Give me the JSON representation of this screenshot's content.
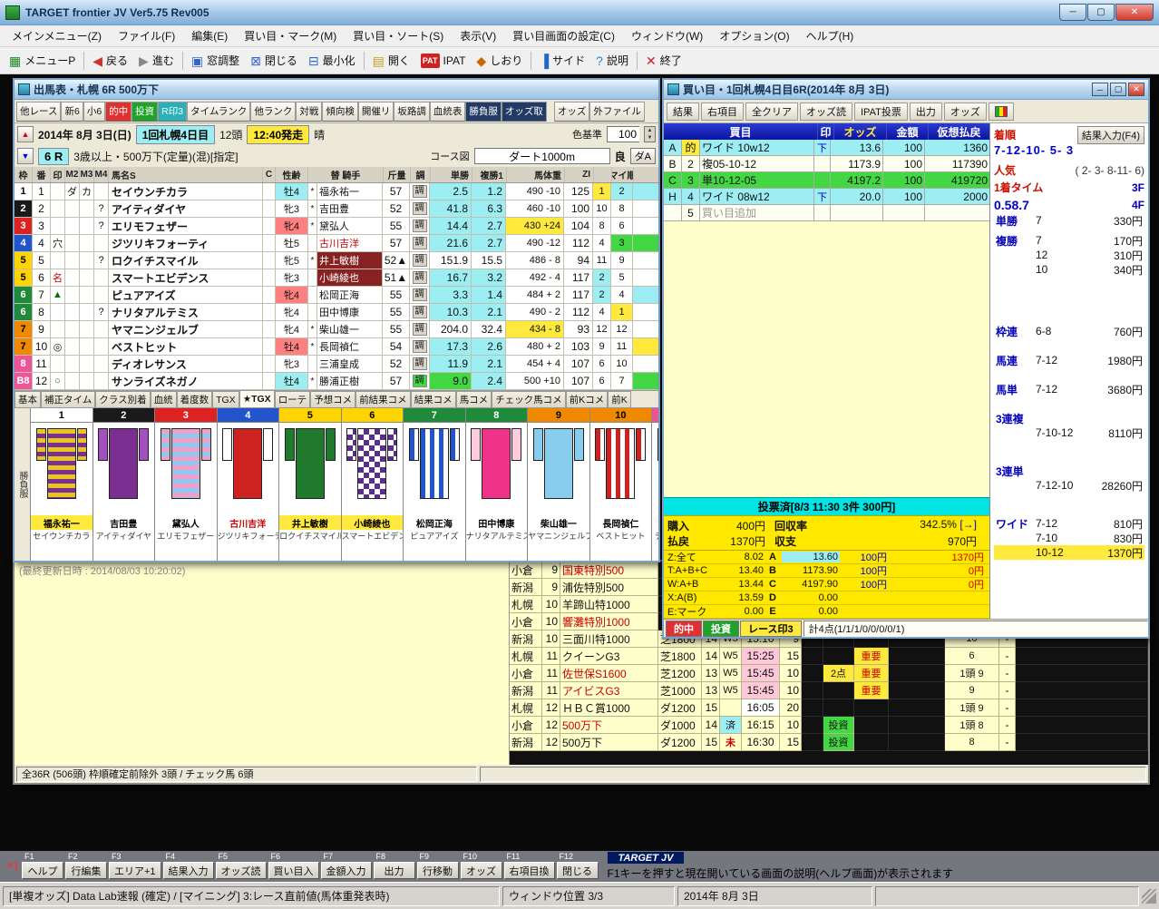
{
  "window": {
    "title": "TARGET frontier JV  Ver5.75  Rev005"
  },
  "menubar": [
    "メインメニュー(Z)",
    "ファイル(F)",
    "編集(E)",
    "買い目・マーク(M)",
    "買い目・ソート(S)",
    "表示(V)",
    "買い目画面の設定(C)",
    "ウィンドウ(W)",
    "オプション(O)",
    "ヘルプ(H)"
  ],
  "toolbar": [
    {
      "label": "メニューP",
      "icon": "▦",
      "ic": "#1a8a22",
      "name": "menu-p"
    },
    {
      "label": "戻る",
      "icon": "◀",
      "ic": "#cc3333",
      "name": "back",
      "sep": true
    },
    {
      "label": "進む",
      "icon": "▶",
      "ic": "#888888",
      "name": "forward"
    },
    {
      "label": "窓調整",
      "icon": "▣",
      "ic": "#3366cc",
      "name": "window-adjust",
      "sep": true
    },
    {
      "label": "閉じる",
      "icon": "⊠",
      "ic": "#3366cc",
      "name": "close-window"
    },
    {
      "label": "最小化",
      "icon": "⊟",
      "ic": "#3366cc",
      "name": "minimize-window"
    },
    {
      "label": "開く",
      "icon": "▤",
      "ic": "#cc9922",
      "name": "open",
      "sep": true
    },
    {
      "label": "IPAT",
      "icon": "PAT",
      "chip": true,
      "name": "ipat"
    },
    {
      "label": "しおり",
      "icon": "◆",
      "ic": "#cc6600",
      "name": "bookmark"
    },
    {
      "label": "サイド",
      "icon": "▐",
      "ic": "#2266cc",
      "name": "side",
      "sep": true
    },
    {
      "label": "説明",
      "icon": "?",
      "ic": "#2288cc",
      "name": "help"
    },
    {
      "label": "終了",
      "icon": "✕",
      "ic": "#cc2222",
      "name": "exit",
      "sep": true
    }
  ],
  "race": {
    "title": "出馬表・札幌 6R 500万下",
    "tabs": [
      {
        "l": "他レース"
      },
      {
        "l": "新6"
      },
      {
        "l": "小6"
      },
      {
        "l": "的中",
        "s": "red"
      },
      {
        "l": "投資",
        "s": "green"
      },
      {
        "l": "R印3",
        "s": "teal"
      },
      {
        "l": "タイムランク"
      },
      {
        "l": "他ランク"
      },
      {
        "l": "対戦"
      },
      {
        "l": "傾向検"
      },
      {
        "l": "開催リ"
      },
      {
        "l": "坂路調"
      },
      {
        "l": "血統表"
      },
      {
        "l": "勝負服",
        "s": "dark"
      },
      {
        "l": "オッズ取",
        "s": "dark"
      },
      {
        "l": "オッズ",
        "gap": true
      },
      {
        "l": "外ファイル"
      }
    ],
    "info": {
      "date": "2014年 8月 3日(日)",
      "meeting": "1回札幌4日目",
      "heads": "12頭",
      "start": "12:40発走",
      "weather": "晴",
      "color_label": "色基準",
      "color_value": "100",
      "race_no": "6 R",
      "cond": "3歳以上・500万下(定量)(混)[指定]",
      "course_label": "コース図",
      "course": "ダート1000m",
      "going": "良",
      "track_btn": "ダA"
    },
    "table": {
      "headers": [
        "枠",
        "番",
        "印",
        "M2",
        "M3",
        "M4",
        "馬名S",
        "C",
        "性齢",
        "替 騎手",
        "斤量",
        "調",
        "単勝",
        "複勝1",
        "馬体重",
        "ZI",
        "",
        "マイ順",
        ""
      ],
      "cho": "調",
      "horses": [
        {
          "waku": "1",
          "wk": 1,
          "num": "1",
          "m2": "ダ",
          "m3": "カ",
          "name": "セイウンチカラ",
          "sex": "牡4",
          "sexc": "cyan",
          "kae": "*",
          "jockey": "福永祐一",
          "kin": "57",
          "tan": "2.5",
          "tc": "cyan",
          "fuku": "1.2",
          "fc": "cyan",
          "wt": "490 -10",
          "zi": "125",
          "zr": "1",
          "zrc": "yellow",
          "mai": "2",
          "mc": "cyan",
          "cut": "cyan"
        },
        {
          "waku": "2",
          "wk": 2,
          "num": "2",
          "m4": "?",
          "name": "アイティダイヤ",
          "sex": "牝3",
          "kae": "*",
          "jockey": "吉田豊",
          "kin": "52",
          "tan": "41.8",
          "tc": "cyan",
          "fuku": "6.3",
          "fc": "cyan",
          "wt": "460 -10",
          "zi": "100",
          "zr": "10",
          "mai": "8"
        },
        {
          "waku": "3",
          "wk": 3,
          "num": "3",
          "m4": "?",
          "name": "エリモフェザー",
          "sex": "牝4",
          "sexc": "red",
          "kae": "*",
          "jockey": "黛弘人",
          "kin": "55",
          "tan": "14.4",
          "tc": "cyan",
          "fuku": "2.7",
          "fc": "cyan",
          "wt": "430 +24",
          "wc": "yellow",
          "zi": "104",
          "zr": "8",
          "mai": "6"
        },
        {
          "waku": "4",
          "wk": 4,
          "num": "4",
          "m1": "穴",
          "name": "ジツリキフォーティ",
          "sex": "牡5",
          "jockey": "古川吉洋",
          "jc": "red",
          "kin": "57",
          "tan": "21.6",
          "tc": "cyan",
          "fuku": "2.7",
          "fc": "cyan",
          "wt": "490 -12",
          "zi": "112",
          "zr": "4",
          "mai": "3",
          "mc": "green",
          "cut": "green"
        },
        {
          "waku": "5",
          "wk": 5,
          "num": "5",
          "m4": "?",
          "name": "ロクイチスマイル",
          "sex": "牝5",
          "kae": "*",
          "jockey": "井上敏樹",
          "jc": "maroon",
          "kin": "52▲",
          "tan": "151.9",
          "fuku": "15.5",
          "wt": "486 - 8",
          "zi": "94",
          "zr": "11",
          "mai": "9"
        },
        {
          "waku": "5",
          "wk": 5,
          "num": "6",
          "m1": "名",
          "m1c": "red",
          "name": "スマートエビデンス",
          "sex": "牝3",
          "jockey": "小崎綾也",
          "jc": "maroon",
          "kin": "51▲",
          "tan": "16.7",
          "tc": "cyan",
          "fuku": "3.2",
          "fc": "cyan",
          "wt": "492 - 4",
          "zi": "117",
          "zr": "2",
          "zrc": "cyan",
          "mai": "5"
        },
        {
          "waku": "6",
          "wk": 6,
          "num": "7",
          "m1": "▲",
          "m1c": "green",
          "name": "ピュアアイズ",
          "sex": "牝4",
          "sexc": "red",
          "jockey": "松岡正海",
          "kin": "55",
          "tan": "3.3",
          "tc": "cyan",
          "fuku": "1.4",
          "fc": "cyan",
          "wt": "484 + 2",
          "zi": "117",
          "zr": "2",
          "zrc": "cyan",
          "mai": "4",
          "cut": "cyan"
        },
        {
          "waku": "6",
          "wk": 6,
          "num": "8",
          "m4": "?",
          "name": "ナリタアルテミス",
          "sex": "牝4",
          "jockey": "田中博康",
          "kin": "55",
          "tan": "10.3",
          "tc": "cyan",
          "fuku": "2.1",
          "fc": "cyan",
          "wt": "490 - 2",
          "zi": "112",
          "zr": "4",
          "mai": "1",
          "mc": "yellow"
        },
        {
          "waku": "7",
          "wk": 7,
          "num": "9",
          "name": "ヤマニンジェルブ",
          "sex": "牝4",
          "kae": "*",
          "jockey": "柴山雄一",
          "kin": "55",
          "tan": "204.0",
          "fuku": "32.4",
          "wt": "434 - 8",
          "wc": "yellow",
          "zi": "93",
          "zr": "12",
          "mai": "12"
        },
        {
          "waku": "7",
          "wk": 7,
          "num": "10",
          "m1": "◎",
          "name": "ベストヒット",
          "sex": "牡4",
          "sexc": "red",
          "kae": "*",
          "jockey": "長岡禎仁",
          "kin": "54",
          "tan": "17.3",
          "tc": "cyan",
          "fuku": "2.6",
          "fc": "cyan",
          "wt": "480 + 2",
          "zi": "103",
          "zr": "9",
          "mai": "11",
          "cut": "yellow"
        },
        {
          "waku": "8",
          "wk": 8,
          "num": "11",
          "name": "ディオレサンス",
          "sex": "牝3",
          "jockey": "三浦皇成",
          "kin": "52",
          "tan": "11.9",
          "tc": "cyan",
          "fuku": "2.1",
          "fc": "cyan",
          "wt": "454 + 4",
          "zi": "107",
          "zr": "6",
          "mai": "10"
        },
        {
          "waku": "B8",
          "wk": 8,
          "num": "12",
          "m1": "○",
          "m1c": "green",
          "name": "サンライズネガノ",
          "sex": "牡4",
          "sexc": "cyan",
          "kae": "*",
          "jockey": "勝浦正樹",
          "kin": "57",
          "choc": "green",
          "tan": "9.0",
          "tc": "green",
          "fuku": "2.4",
          "fc": "cyan",
          "wt": "500 +10",
          "zi": "107",
          "zr": "6",
          "mai": "7",
          "cut": "green"
        }
      ]
    },
    "bottom_tabs": [
      {
        "l": "基本"
      },
      {
        "l": "補正タイム"
      },
      {
        "l": "クラス別着"
      },
      {
        "l": "血統"
      },
      {
        "l": "着度数"
      },
      {
        "l": "TGX"
      },
      {
        "l": "★TGX",
        "active": true
      },
      {
        "l": "ローテ"
      },
      {
        "l": "予想コメ"
      },
      {
        "l": "前結果コメ"
      },
      {
        "l": "結果コメ"
      },
      {
        "l": "馬コメ"
      },
      {
        "l": "チェック馬コメ"
      },
      {
        "l": "前Kコメ"
      },
      {
        "l": "前K"
      }
    ],
    "silks_tab": "勝負服",
    "silks": [
      {
        "num": "1",
        "waku": "#ffffff",
        "wtc": "#000",
        "jockey": "福永祐一",
        "js": "hl",
        "horse": "セイウンチカラ",
        "p": "h",
        "a": "#e8c520",
        "b": "#7b2f91"
      },
      {
        "num": "2",
        "waku": "#1a1a1a",
        "wtc": "#fff",
        "jockey": "吉田豊",
        "horse": "アイティダイヤ",
        "p": "s",
        "a": "#7b2f91",
        "b": "#a34fc0"
      },
      {
        "num": "3",
        "waku": "#dd2222",
        "wtc": "#fff",
        "jockey": "黛弘人",
        "horse": "エリモフェザー",
        "p": "h",
        "a": "#f0a0c8",
        "b": "#90c8f0"
      },
      {
        "num": "4",
        "waku": "#2255cc",
        "wtc": "#fff",
        "jockey": "古川吉洋",
        "js": "red",
        "horse": "ジツリキフォーティ",
        "p": "s",
        "a": "#cc2222",
        "b": "#ffffff"
      },
      {
        "num": "5",
        "waku": "#ffd400",
        "wtc": "#000",
        "jockey": "井上敏樹",
        "js": "hl",
        "horse": "ロクイチスマイル",
        "p": "s",
        "a": "#1f7a2d",
        "b": "#1f7a2d"
      },
      {
        "num": "6",
        "waku": "#ffd400",
        "wtc": "#000",
        "jockey": "小崎綾也",
        "js": "hl",
        "horse": "スマートエビデンス",
        "p": "c",
        "a": "#ffffff",
        "b": "#5b2d91"
      },
      {
        "num": "7",
        "waku": "#1f8a3a",
        "wtc": "#fff",
        "jockey": "松岡正海",
        "horse": "ピュアアイズ",
        "p": "v",
        "a": "#2255cc",
        "b": "#ffffff"
      },
      {
        "num": "8",
        "waku": "#1f8a3a",
        "wtc": "#fff",
        "jockey": "田中博康",
        "horse": "ナリタアルテミス",
        "p": "s",
        "a": "#ee3388",
        "b": "#ffccdd"
      },
      {
        "num": "9",
        "waku": "#f08800",
        "wtc": "#000",
        "jockey": "柴山雄一",
        "horse": "ヤマニンジェルブ",
        "p": "s",
        "a": "#88ccee",
        "b": "#88ccee"
      },
      {
        "num": "10",
        "waku": "#f08800",
        "wtc": "#000",
        "jockey": "長岡禎仁",
        "horse": "ベストヒット",
        "p": "v",
        "a": "#cc2222",
        "b": "#ffffff"
      },
      {
        "num": "11",
        "waku": "#ee5599",
        "wtc": "#fff",
        "jockey": "三浦皇成",
        "horse": "ディオレサンス",
        "p": "x",
        "a": "#ffffff",
        "b": "#cc2222"
      },
      {
        "num": "12",
        "waku": "#ee5599",
        "wtc": "#fff",
        "jockey": "勝浦正樹",
        "horse": "サンライズネガノ",
        "p": "d",
        "a": "#5b2d91",
        "b": "#ffffff"
      }
    ]
  },
  "list": {
    "updated": "(最終更新日時 : 2014/08/03 10:20:02)",
    "rows": [
      {
        "v": "小倉",
        "no": "9",
        "name": "国東特別500",
        "red": true
      },
      {
        "v": "新潟",
        "no": "9",
        "name": "浦佐特別500"
      },
      {
        "v": "札幌",
        "no": "10",
        "name": "羊蹄山特1000"
      },
      {
        "v": "小倉",
        "no": "10",
        "name": "響灘特別1000",
        "red": true
      },
      {
        "v": "新潟",
        "no": "10",
        "name": "三面川特1000",
        "course": "芝1800",
        "heads": "14",
        "flag": "W5",
        "time": "15:10",
        "cnt": "9",
        "val": "10",
        "dash": "-"
      },
      {
        "v": "札幌",
        "no": "11",
        "name": "クイーンG3",
        "course": "芝1800",
        "heads": "14",
        "flag": "W5",
        "time": "15:25",
        "tbg": "pink",
        "cnt": "15",
        "tag2": "重要",
        "val": "6",
        "dash": "-"
      },
      {
        "v": "小倉",
        "no": "11",
        "name": "佐世保S1600",
        "red": true,
        "course": "芝1200",
        "heads": "13",
        "flag": "W5",
        "time": "15:45",
        "tbg": "pink",
        "cnt": "10",
        "tag1": "2点",
        "tag2": "重要",
        "val": "1頭 9",
        "dash": "-"
      },
      {
        "v": "新潟",
        "no": "11",
        "name": "アイビスG3",
        "red": true,
        "course": "芝1000",
        "heads": "13",
        "flag": "W5",
        "time": "15:45",
        "tbg": "pink",
        "cnt": "10",
        "tag2": "重要",
        "val": "9",
        "dash": "-"
      },
      {
        "v": "札幌",
        "no": "12",
        "name": "ＨＢＣ賞1000",
        "course": "ダ1200",
        "heads": "15",
        "time": "16:05",
        "tbg": "white",
        "cnt": "20",
        "val": "1頭 9",
        "dash": "-"
      },
      {
        "v": "小倉",
        "no": "12",
        "name": "500万下",
        "red": true,
        "course": "ダ1000",
        "heads": "14",
        "flag": "済",
        "time": "16:15",
        "cnt": "10",
        "tag1": "投資",
        "val": "1頭 8",
        "dash": "-"
      },
      {
        "v": "新潟",
        "no": "12",
        "name": "500万下",
        "course": "ダ1200",
        "heads": "15",
        "flag": "未",
        "time": "16:30",
        "cnt": "15",
        "tag1": "投資",
        "val": "8",
        "dash": "-"
      }
    ],
    "status": "全36R (506頭) 枠順確定前除外 3頭  / チェック馬 6頭"
  },
  "bet": {
    "title": "買い目・1回札幌4日目6R(2014年 8月 3日)",
    "toolbar": [
      "結果",
      "右項目",
      "全クリア",
      "オッズ読",
      "IPAT投票",
      "出力",
      "オッズ"
    ],
    "table": {
      "headers": [
        "買目",
        "印",
        "オッズ",
        "金額",
        "仮想払戻"
      ],
      "rows": [
        {
          "r": "A",
          "m": "的",
          "mbg": "yellow",
          "bet": "ワイド 10w12",
          "dir": "下",
          "odds": "13.6",
          "amt": "100",
          "pay": "1360",
          "bg": "cyan"
        },
        {
          "r": "B",
          "m": "2",
          "bet": "複05-10-12",
          "odds": "1173.9",
          "amt": "100",
          "pay": "117390"
        },
        {
          "r": "C",
          "m": "3",
          "bet": "単10-12-05",
          "odds": "4197.2",
          "amt": "100",
          "pay": "419720",
          "bg": "green"
        },
        {
          "r": "H",
          "m": "4",
          "bet": "ワイド 08w12",
          "dir": "下",
          "odds": "20.0",
          "amt": "100",
          "pay": "2000",
          "bg": "cyan"
        },
        {
          "m": "5",
          "bet": "買い目追加",
          "dim": true
        }
      ]
    },
    "voted": "投票済[8/3 11:30 3件 300円]",
    "summary": {
      "purchase_label": "購入",
      "purchase": "400円",
      "payback_label": "払戻",
      "payback": "1370円",
      "rate_label": "回収率",
      "rate": "342.5%",
      "rate_arrow": "[→]",
      "balance_label": "収支",
      "balance": "970円"
    },
    "calc": [
      {
        "k": "Z:全て",
        "v": "8.02",
        "k2": "A",
        "v2": "13.60",
        "v2bg": "cyan",
        "amt": "100円",
        "pay": "1370円"
      },
      {
        "k": "T:A+B+C",
        "v": "13.40",
        "k2": "B",
        "v2": "1173.90",
        "amt": "100円",
        "pay": "0円"
      },
      {
        "k": "W:A+B",
        "v": "13.44",
        "k2": "C",
        "v2": "4197.90",
        "amt": "100円",
        "pay": "0円"
      },
      {
        "k": "X:A(B)",
        "v": "13.59",
        "k2": "D",
        "v2": "0.00"
      },
      {
        "k": "E:マーク",
        "v": "0.00",
        "k2": "E",
        "v2": "0.00"
      }
    ],
    "tabs": [
      {
        "l": "的中",
        "s": "red"
      },
      {
        "l": "投資",
        "s": "green"
      },
      {
        "l": "レース印3",
        "s": "yellow"
      }
    ],
    "points": "計4点(1/1/1/0/0/0/0/1)",
    "result": {
      "order_label": "着順",
      "enter": "結果入力(F4)",
      "order": "7-12-10- 5- 3",
      "pop_label": "人気",
      "pop": "( 2- 3- 8-11- 6)",
      "t_label": "1着タイム",
      "f3": "3F",
      "time": "0.58.7",
      "f4": "4F",
      "payouts": [
        {
          "t": "単勝",
          "c": "7",
          "a": "330円"
        },
        {
          "t": "複勝",
          "c": "7",
          "a": "170円",
          "g": "s"
        },
        {
          "c": "12",
          "a": "310円"
        },
        {
          "c": "10",
          "a": "340円"
        },
        {
          "t": "枠連",
          "c": "6-8",
          "a": "760円",
          "g": "l"
        },
        {
          "t": "馬連",
          "c": "7-12",
          "a": "1980円",
          "g": "m"
        },
        {
          "t": "馬単",
          "c": "7-12",
          "a": "3680円",
          "g": "m"
        },
        {
          "t": "3連複",
          "solo": true,
          "g": "m"
        },
        {
          "c": "7-10-12",
          "a": "8110円"
        },
        {
          "t": "3連単",
          "solo": true,
          "g": "x"
        },
        {
          "c": "7-12-10",
          "a": "28260円"
        },
        {
          "t": "ワイド",
          "c": "7-12",
          "a": "810円",
          "g": "x"
        },
        {
          "c": "7-10",
          "a": "830円"
        },
        {
          "c": "10-12",
          "a": "1370円",
          "hl": true
        }
      ]
    }
  },
  "fkeys": {
    "keys": [
      {
        "f": "F1",
        "label": "ヘルプ"
      },
      {
        "f": "F2",
        "label": "行編集"
      },
      {
        "f": "F3",
        "label": "エリア+1"
      },
      {
        "f": "F4",
        "label": "結果入力"
      },
      {
        "f": "F5",
        "label": "オッズ読"
      },
      {
        "f": "F6",
        "label": "買い目入"
      },
      {
        "f": "F7",
        "label": "金額入力"
      },
      {
        "f": "F8",
        "label": "出力"
      },
      {
        "f": "F9",
        "label": "行移動"
      },
      {
        "f": "F10",
        "label": "オッズ"
      },
      {
        "f": "F11",
        "label": "右項目換"
      },
      {
        "f": "F12",
        "label": "閉じる"
      }
    ],
    "brand": "TARGET JV",
    "message": "F1キーを押すと現在開いている画面の説明(ヘルプ画面)が表示されます"
  },
  "statusbar": {
    "left": "[単複オッズ] Data Lab速報 (確定) / [マイニング] 3:レース直前値(馬体重発表時)",
    "mid": "ウィンドウ位置 3/3",
    "right": "2014年 8月 3日"
  }
}
